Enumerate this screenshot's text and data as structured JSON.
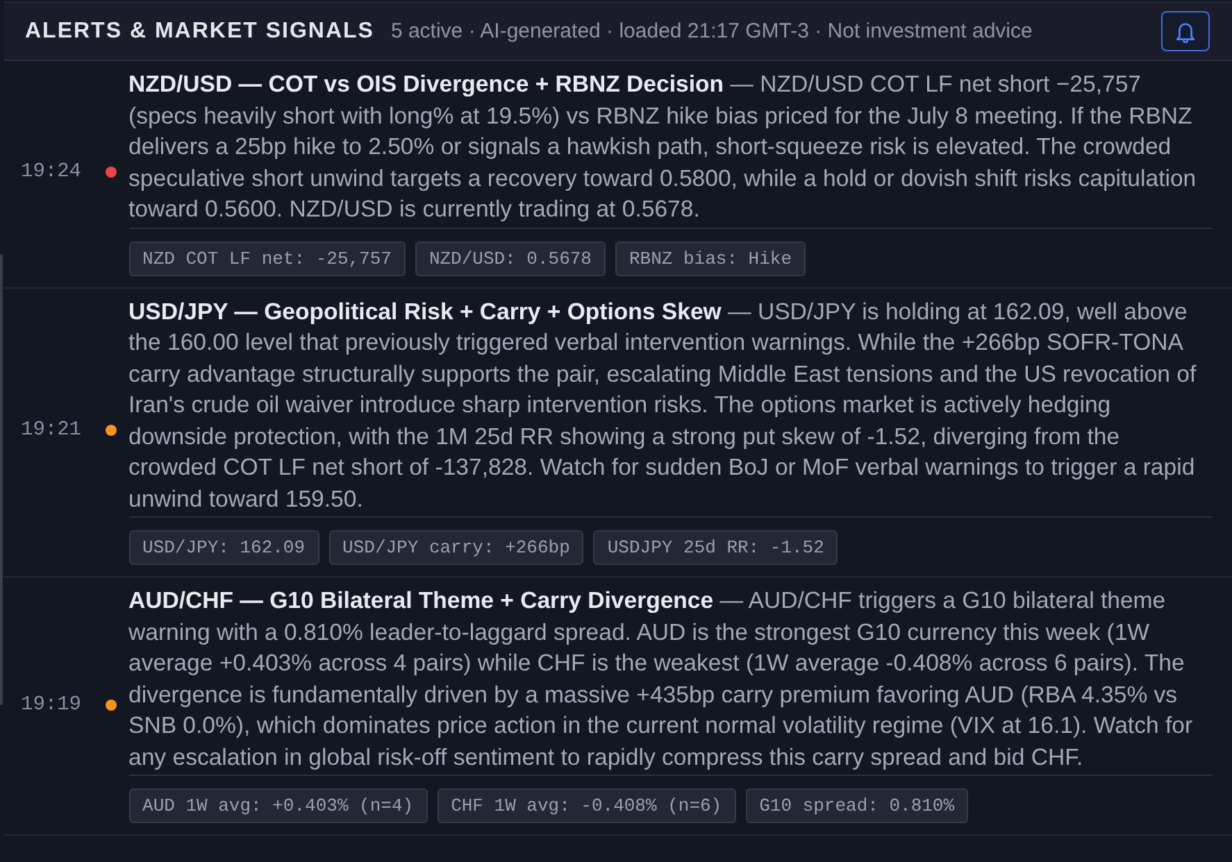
{
  "header": {
    "title": "ALERTS & MARKET SIGNALS",
    "meta": "5 active · AI-generated · loaded 21:17 GMT-3 · Not investment advice"
  },
  "alerts": [
    {
      "time": "19:24",
      "color": "#ef4444",
      "text": "**NZD/USD — COT vs OIS Divergence + RBNZ Decision** — NZD/USD COT LF net short −25,757 (specs heavily short with long% at 19.5%) vs RBNZ hike bias priced for the July 8 meeting. If the RBNZ delivers a 25bp hike to 2.50% or signals a hawkish path, short-squeeze risk is elevated. The crowded speculative short unwind targets a recovery toward 0.5800, while a hold or dovish shift risks capitulation toward 0.5600. NZD/USD is currently trading at 0.5678.",
      "tags": [
        "NZD COT LF net: -25,757",
        "NZD/USD: 0.5678",
        "RBNZ bias: Hike"
      ]
    },
    {
      "time": "19:21",
      "color": "#f7931e",
      "text": "**USD/JPY — Geopolitical Risk + Carry + Options Skew** — USD/JPY is holding at 162.09, well above the 160.00 level that previously triggered verbal intervention warnings. While the +266bp SOFR-TONA carry advantage structurally supports the pair, escalating Middle East tensions and the US revocation of Iran's crude oil waiver introduce sharp intervention risks. The options market is actively hedging downside protection, with the 1M 25d RR showing a strong put skew of -1.52, diverging from the crowded COT LF net short of -137,828. Watch for sudden BoJ or MoF verbal warnings to trigger a rapid unwind toward 159.50.",
      "tags": [
        "USD/JPY: 162.09",
        "USD/JPY carry: +266bp",
        "USDJPY 25d RR: -1.52"
      ]
    },
    {
      "time": "19:19",
      "color": "#f7931e",
      "text": "**AUD/CHF — G10 Bilateral Theme + Carry Divergence** — AUD/CHF triggers a G10 bilateral theme warning with a 0.810% leader-to-laggard spread. AUD is the strongest G10 currency this week (1W average +0.403% across 4 pairs) while CHF is the weakest (1W average -0.408% across 6 pairs). The divergence is fundamentally driven by a massive +435bp carry premium favoring AUD (RBA 4.35% vs SNB 0.0%), which dominates price action in the current normal volatility regime (VIX at 16.1). Watch for any escalation in global risk-off sentiment to rapidly compress this carry spread and bid CHF.",
      "tags": [
        "AUD 1W avg: +0.403% (n=4)",
        "CHF 1W avg: -0.408% (n=6)",
        "G10 spread: 0.810%"
      ]
    }
  ]
}
